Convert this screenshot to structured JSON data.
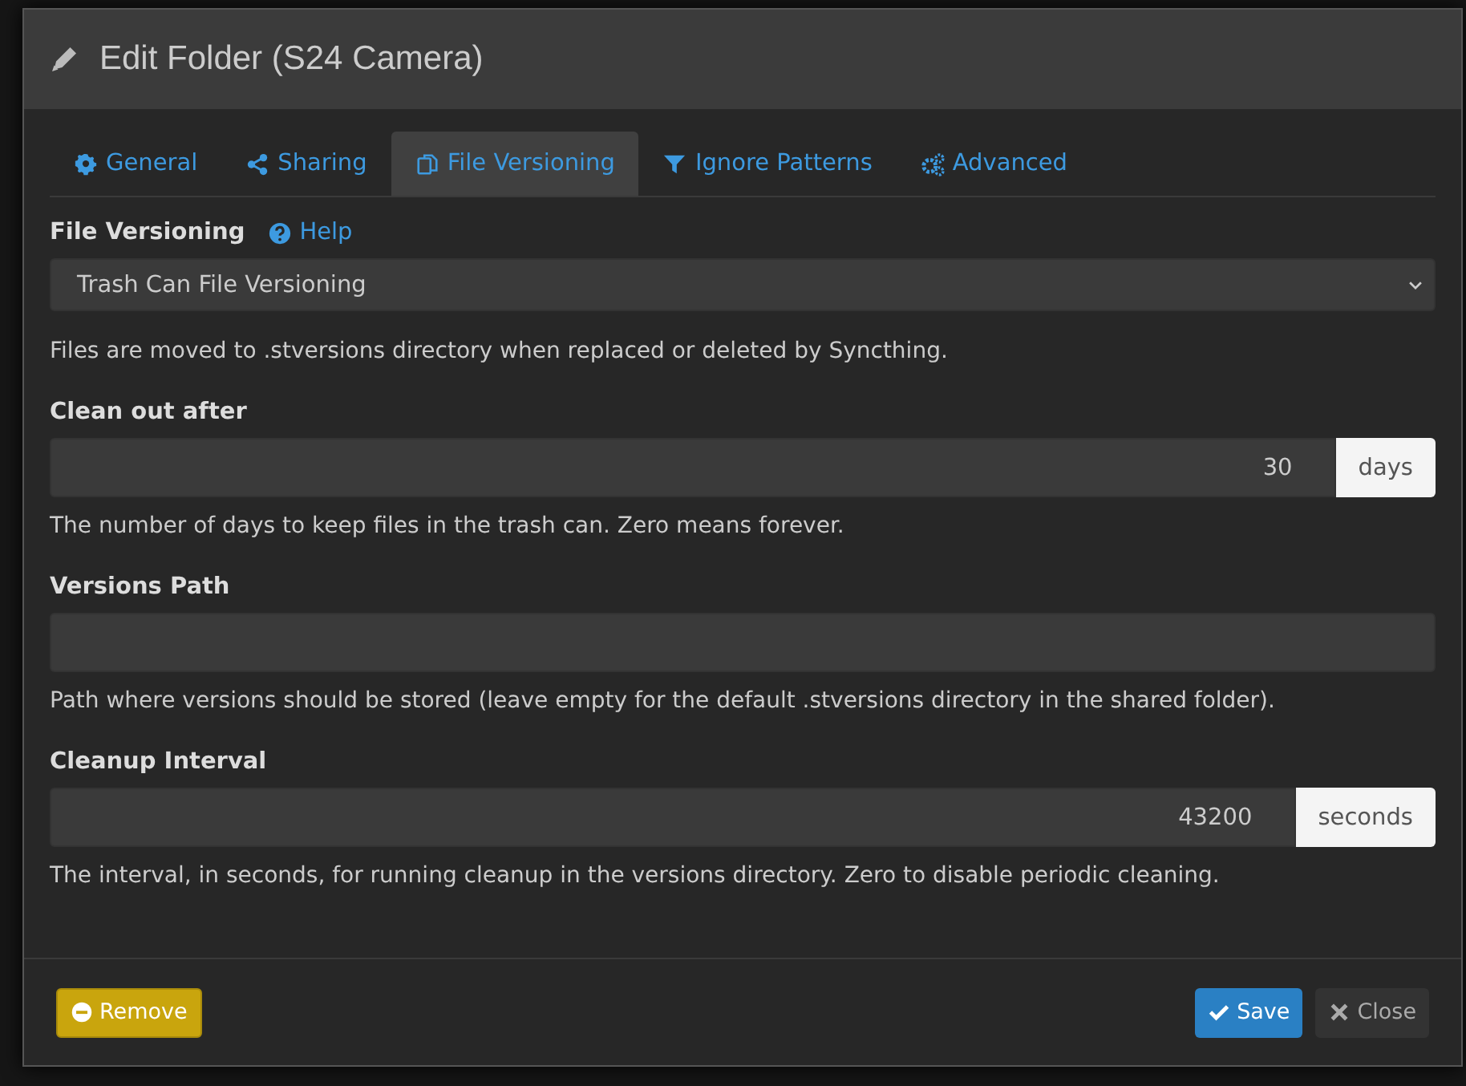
{
  "dialog": {
    "title": "Edit Folder (S24 Camera)",
    "tabs": [
      {
        "label": "General",
        "selected": false
      },
      {
        "label": "Sharing",
        "selected": false
      },
      {
        "label": "File Versioning",
        "selected": true
      },
      {
        "label": "Ignore Patterns",
        "selected": false
      },
      {
        "label": "Advanced",
        "selected": false
      }
    ],
    "versioning": {
      "label": "File Versioning",
      "help_link": "Help",
      "value": "Trash Can File Versioning",
      "description": "Files are moved to .stversions directory when replaced or deleted by Syncthing."
    },
    "fields": [
      {
        "label": "Clean out after",
        "value": "30",
        "unit": "days",
        "help": "The number of days to keep files in the trash can. Zero means forever."
      },
      {
        "label": "Versions Path",
        "help": "Path where versions should be stored (leave empty for the default .stversions directory in the shared folder)."
      },
      {
        "label": "Cleanup Interval",
        "value": "43200",
        "unit": "seconds",
        "help": "The interval, in seconds, for running cleanup in the versions directory. Zero to disable periodic cleaning."
      }
    ],
    "buttons": [
      {
        "label": "Remove",
        "kind": "danger"
      },
      {
        "label": "Save",
        "kind": "primary"
      },
      {
        "label": "Close",
        "kind": "default"
      }
    ]
  }
}
